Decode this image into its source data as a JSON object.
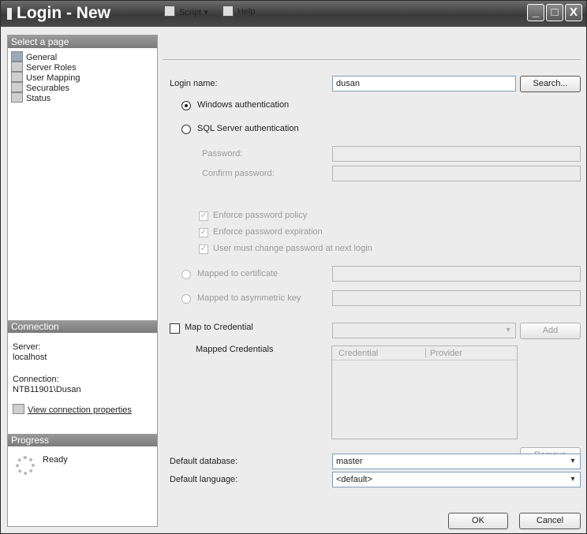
{
  "window": {
    "title": "Login - New",
    "minimize_glyph": "_",
    "maximize_glyph": "□",
    "close_glyph": "X"
  },
  "sidebar": {
    "select_page_header": "Select a page",
    "items": [
      {
        "label": "General",
        "icon": "page-icon"
      },
      {
        "label": "Server Roles",
        "icon": "page-icon"
      },
      {
        "label": "User Mapping",
        "icon": "page-icon"
      },
      {
        "label": "Securables",
        "icon": "page-icon"
      },
      {
        "label": "Status",
        "icon": "page-icon"
      }
    ],
    "connection_header": "Connection",
    "server_label": "Server:",
    "server_value": "localhost",
    "connection_label": "Connection:",
    "connection_value": "NTB11901\\Dusan",
    "view_properties_link": "View connection properties",
    "progress_header": "Progress",
    "progress_status": "Ready"
  },
  "toolbar": {
    "script_label": "Script",
    "script_arrow": "▾",
    "help_label": "Help"
  },
  "form": {
    "login_name_label": "Login name:",
    "login_name_value": "dusan",
    "search_button": "Search...",
    "windows_auth_label": "Windows authentication",
    "sql_auth_label": "SQL Server authentication",
    "password_label": "Password:",
    "confirm_password_label": "Confirm password:",
    "enforce_policy_label": "Enforce password policy",
    "enforce_expiration_label": "Enforce password expiration",
    "must_change_label": "User must change password at next login",
    "check_glyph": "✓",
    "mapped_cert_label": "Mapped to certificate",
    "mapped_asym_label": "Mapped to asymmetric key",
    "map_credential_label": "Map to Credential",
    "add_button": "Add",
    "mapped_credentials_label": "Mapped Credentials",
    "credentials_columns": [
      "Credential",
      "Provider"
    ],
    "remove_button": "Remove",
    "default_database_label": "Default database:",
    "default_database_value": "master",
    "default_language_label": "Default language:",
    "default_language_value": "<default>",
    "dropdown_glyph": "▾"
  },
  "footer": {
    "ok_button": "OK",
    "cancel_button": "Cancel"
  }
}
